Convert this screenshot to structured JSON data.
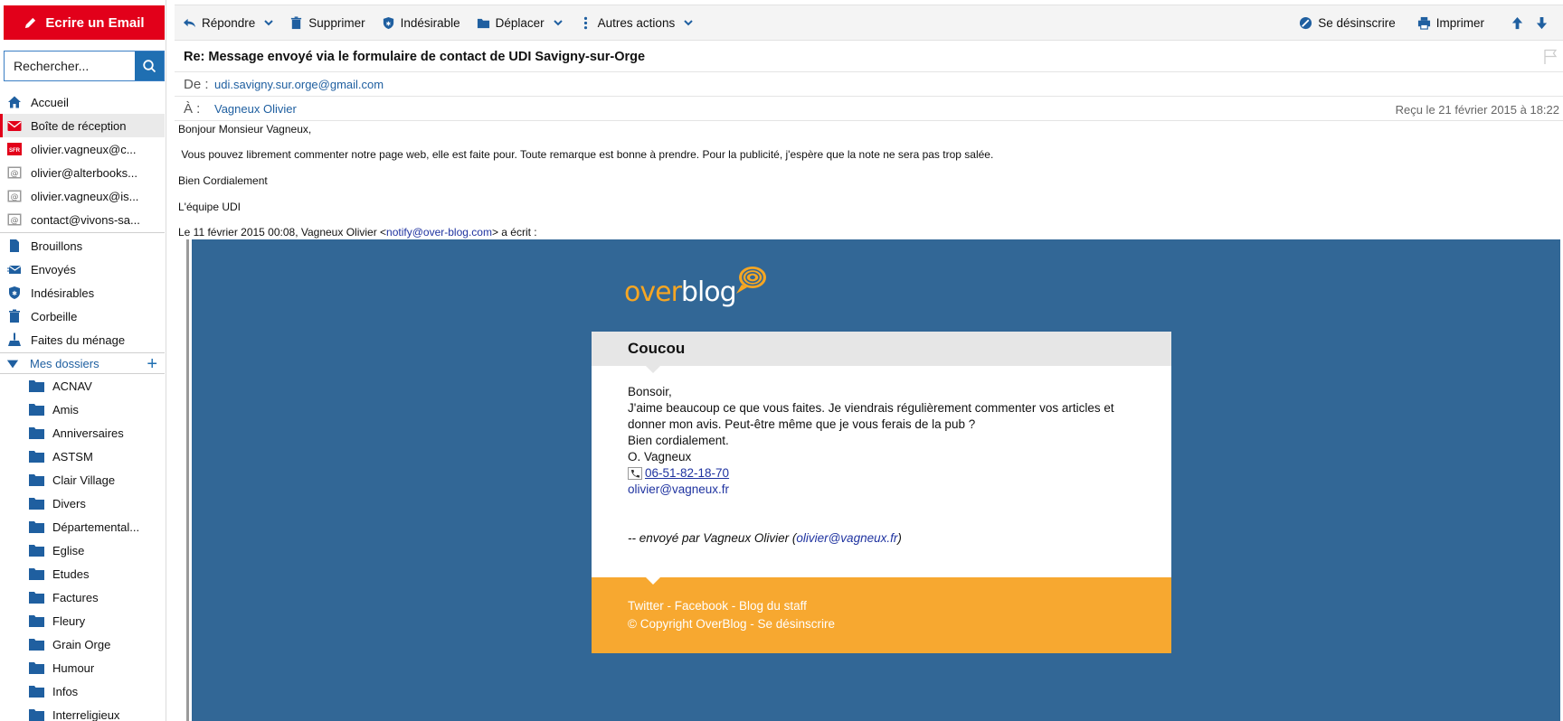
{
  "sidebar": {
    "compose_label": "Ecrire un Email",
    "search_placeholder": "Rechercher...",
    "nav": [
      {
        "label": "Accueil",
        "icon": "home-icon"
      },
      {
        "label": "Boîte de réception",
        "icon": "inbox-icon"
      },
      {
        "label": "olivier.vagneux@c...",
        "icon": "sfr-account-icon",
        "badge": "SFR"
      },
      {
        "label": "olivier@alterbooks...",
        "icon": "at-account-icon"
      },
      {
        "label": "olivier.vagneux@is...",
        "icon": "at-account-icon"
      },
      {
        "label": "contact@vivons-sa...",
        "icon": "at-account-icon"
      },
      {
        "label": "Brouillons",
        "icon": "drafts-icon"
      },
      {
        "label": "Envoyés",
        "icon": "sent-icon"
      },
      {
        "label": "Indésirables",
        "icon": "spam-shield-icon"
      },
      {
        "label": "Corbeille",
        "icon": "trash-icon"
      },
      {
        "label": "Faites du ménage",
        "icon": "broom-icon"
      }
    ],
    "folders_label": "Mes dossiers",
    "folders": [
      "ACNAV",
      "Amis",
      "Anniversaires",
      "ASTSM",
      "Clair Village",
      "Divers",
      "Départemental...",
      "Eglise",
      "Etudes",
      "Factures",
      "Fleury",
      "Grain Orge",
      "Humour",
      "Infos",
      "Interreligieux"
    ]
  },
  "toolbar": {
    "reply": "Répondre",
    "delete": "Supprimer",
    "spam": "Indésirable",
    "move": "Déplacer",
    "more": "Autres actions",
    "unsubscribe": "Se désinscrire",
    "print": "Imprimer"
  },
  "message": {
    "subject": "Re: Message envoyé via le formulaire de contact de UDI Savigny-sur-Orge",
    "from_label": "De :",
    "from": "udi.savigny.sur.orge@gmail.com",
    "to_label": "À :",
    "to": "Vagneux Olivier",
    "received": "Reçu le 21 février 2015 à 18:22",
    "body": {
      "greeting": "Bonjour Monsieur Vagneux,",
      "line1": " Vous pouvez librement commenter notre page web, elle est faite pour. Toute remarque est bonne à prendre. Pour la publicité, j'espère que la note ne sera pas trop salée.",
      "closing": "Bien Cordialement",
      "signature": "L'équipe UDI",
      "quote_intro_prefix": "Le 11 février 2015 00:08, Vagneux Olivier <",
      "quote_intro_email": "notify@over-blog.com",
      "quote_intro_suffix": "> a écrit :"
    }
  },
  "overblog": {
    "logo_over": "over",
    "logo_blog": "blog",
    "title": "Coucou",
    "lines": [
      "Bonsoir,",
      "J'aime beaucoup ce que vous faites. Je viendrais régulièrement commenter vos articles et donner mon avis. Peut-être même que je vous ferais de la pub ?",
      "Bien cordialement.",
      "O. Vagneux"
    ],
    "phone": "06-51-82-18-70",
    "email": "olivier@vagneux.fr",
    "sent_prefix": "-- envoyé par Vagneux Olivier (",
    "sent_email": "olivier@vagneux.fr",
    "sent_suffix": ")",
    "footer_line1": "Twitter - Facebook - Blog du staff",
    "footer_line2": "© Copyright OverBlog - Se désinscrire"
  },
  "colors": {
    "brand_red": "#e2001a",
    "link_blue": "#1f5fa0",
    "overblog_bg": "#326796",
    "overblog_orange": "#f7a830"
  }
}
